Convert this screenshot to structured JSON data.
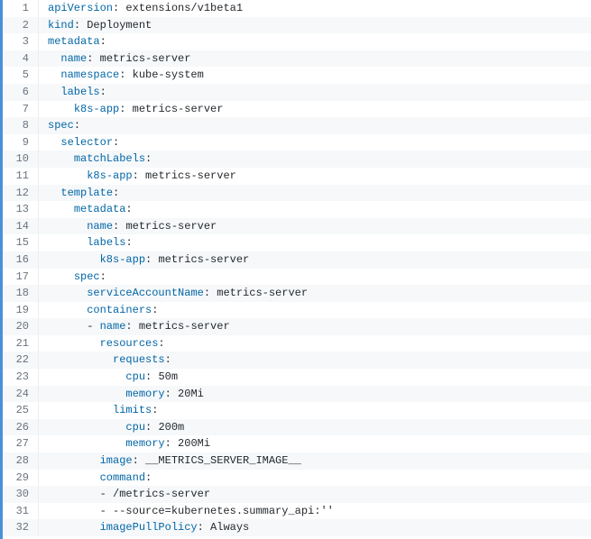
{
  "lines": [
    {
      "num": "1",
      "segments": [
        {
          "t": "apiVersion",
          "c": "k"
        },
        {
          "t": ": ",
          "c": "d"
        },
        {
          "t": "extensions/v1beta1",
          "c": "v"
        }
      ]
    },
    {
      "num": "2",
      "segments": [
        {
          "t": "kind",
          "c": "k"
        },
        {
          "t": ": ",
          "c": "d"
        },
        {
          "t": "Deployment",
          "c": "v"
        }
      ]
    },
    {
      "num": "3",
      "segments": [
        {
          "t": "metadata",
          "c": "k"
        },
        {
          "t": ":",
          "c": "d"
        }
      ]
    },
    {
      "num": "4",
      "segments": [
        {
          "t": "  ",
          "c": "d"
        },
        {
          "t": "name",
          "c": "k"
        },
        {
          "t": ": ",
          "c": "d"
        },
        {
          "t": "metrics-server",
          "c": "v"
        }
      ]
    },
    {
      "num": "5",
      "segments": [
        {
          "t": "  ",
          "c": "d"
        },
        {
          "t": "namespace",
          "c": "k"
        },
        {
          "t": ": ",
          "c": "d"
        },
        {
          "t": "kube-system",
          "c": "v"
        }
      ]
    },
    {
      "num": "6",
      "segments": [
        {
          "t": "  ",
          "c": "d"
        },
        {
          "t": "labels",
          "c": "k"
        },
        {
          "t": ":",
          "c": "d"
        }
      ]
    },
    {
      "num": "7",
      "segments": [
        {
          "t": "    ",
          "c": "d"
        },
        {
          "t": "k8s-app",
          "c": "k"
        },
        {
          "t": ": ",
          "c": "d"
        },
        {
          "t": "metrics-server",
          "c": "v"
        }
      ]
    },
    {
      "num": "8",
      "segments": [
        {
          "t": "spec",
          "c": "k"
        },
        {
          "t": ":",
          "c": "d"
        }
      ]
    },
    {
      "num": "9",
      "segments": [
        {
          "t": "  ",
          "c": "d"
        },
        {
          "t": "selector",
          "c": "k"
        },
        {
          "t": ":",
          "c": "d"
        }
      ]
    },
    {
      "num": "10",
      "segments": [
        {
          "t": "    ",
          "c": "d"
        },
        {
          "t": "matchLabels",
          "c": "k"
        },
        {
          "t": ":",
          "c": "d"
        }
      ]
    },
    {
      "num": "11",
      "segments": [
        {
          "t": "      ",
          "c": "d"
        },
        {
          "t": "k8s-app",
          "c": "k"
        },
        {
          "t": ": ",
          "c": "d"
        },
        {
          "t": "metrics-server",
          "c": "v"
        }
      ]
    },
    {
      "num": "12",
      "segments": [
        {
          "t": "  ",
          "c": "d"
        },
        {
          "t": "template",
          "c": "k"
        },
        {
          "t": ":",
          "c": "d"
        }
      ]
    },
    {
      "num": "13",
      "segments": [
        {
          "t": "    ",
          "c": "d"
        },
        {
          "t": "metadata",
          "c": "k"
        },
        {
          "t": ":",
          "c": "d"
        }
      ]
    },
    {
      "num": "14",
      "segments": [
        {
          "t": "      ",
          "c": "d"
        },
        {
          "t": "name",
          "c": "k"
        },
        {
          "t": ": ",
          "c": "d"
        },
        {
          "t": "metrics-server",
          "c": "v"
        }
      ]
    },
    {
      "num": "15",
      "segments": [
        {
          "t": "      ",
          "c": "d"
        },
        {
          "t": "labels",
          "c": "k"
        },
        {
          "t": ":",
          "c": "d"
        }
      ]
    },
    {
      "num": "16",
      "segments": [
        {
          "t": "        ",
          "c": "d"
        },
        {
          "t": "k8s-app",
          "c": "k"
        },
        {
          "t": ": ",
          "c": "d"
        },
        {
          "t": "metrics-server",
          "c": "v"
        }
      ]
    },
    {
      "num": "17",
      "segments": [
        {
          "t": "    ",
          "c": "d"
        },
        {
          "t": "spec",
          "c": "k"
        },
        {
          "t": ":",
          "c": "d"
        }
      ]
    },
    {
      "num": "18",
      "segments": [
        {
          "t": "      ",
          "c": "d"
        },
        {
          "t": "serviceAccountName",
          "c": "k"
        },
        {
          "t": ": ",
          "c": "d"
        },
        {
          "t": "metrics-server",
          "c": "v"
        }
      ]
    },
    {
      "num": "19",
      "segments": [
        {
          "t": "      ",
          "c": "d"
        },
        {
          "t": "containers",
          "c": "k"
        },
        {
          "t": ":",
          "c": "d"
        }
      ]
    },
    {
      "num": "20",
      "segments": [
        {
          "t": "      - ",
          "c": "d"
        },
        {
          "t": "name",
          "c": "k"
        },
        {
          "t": ": ",
          "c": "d"
        },
        {
          "t": "metrics-server",
          "c": "v"
        }
      ]
    },
    {
      "num": "21",
      "segments": [
        {
          "t": "        ",
          "c": "d"
        },
        {
          "t": "resources",
          "c": "k"
        },
        {
          "t": ":",
          "c": "d"
        }
      ]
    },
    {
      "num": "22",
      "segments": [
        {
          "t": "          ",
          "c": "d"
        },
        {
          "t": "requests",
          "c": "k"
        },
        {
          "t": ":",
          "c": "d"
        }
      ]
    },
    {
      "num": "23",
      "segments": [
        {
          "t": "            ",
          "c": "d"
        },
        {
          "t": "cpu",
          "c": "k"
        },
        {
          "t": ": ",
          "c": "d"
        },
        {
          "t": "50m",
          "c": "v"
        }
      ]
    },
    {
      "num": "24",
      "segments": [
        {
          "t": "            ",
          "c": "d"
        },
        {
          "t": "memory",
          "c": "k"
        },
        {
          "t": ": ",
          "c": "d"
        },
        {
          "t": "20Mi",
          "c": "v"
        }
      ]
    },
    {
      "num": "25",
      "segments": [
        {
          "t": "          ",
          "c": "d"
        },
        {
          "t": "limits",
          "c": "k"
        },
        {
          "t": ":",
          "c": "d"
        }
      ]
    },
    {
      "num": "26",
      "segments": [
        {
          "t": "            ",
          "c": "d"
        },
        {
          "t": "cpu",
          "c": "k"
        },
        {
          "t": ": ",
          "c": "d"
        },
        {
          "t": "200m",
          "c": "v"
        }
      ]
    },
    {
      "num": "27",
      "segments": [
        {
          "t": "            ",
          "c": "d"
        },
        {
          "t": "memory",
          "c": "k"
        },
        {
          "t": ": ",
          "c": "d"
        },
        {
          "t": "200Mi",
          "c": "v"
        }
      ]
    },
    {
      "num": "28",
      "segments": [
        {
          "t": "        ",
          "c": "d"
        },
        {
          "t": "image",
          "c": "k"
        },
        {
          "t": ": ",
          "c": "d"
        },
        {
          "t": "__METRICS_SERVER_IMAGE__",
          "c": "v"
        }
      ]
    },
    {
      "num": "29",
      "segments": [
        {
          "t": "        ",
          "c": "d"
        },
        {
          "t": "command",
          "c": "k"
        },
        {
          "t": ":",
          "c": "d"
        }
      ]
    },
    {
      "num": "30",
      "segments": [
        {
          "t": "        - ",
          "c": "d"
        },
        {
          "t": "/metrics-server",
          "c": "v"
        }
      ]
    },
    {
      "num": "31",
      "segments": [
        {
          "t": "        - ",
          "c": "d"
        },
        {
          "t": "--source=kubernetes.summary_api:''",
          "c": "v"
        }
      ]
    },
    {
      "num": "32",
      "segments": [
        {
          "t": "        ",
          "c": "d"
        },
        {
          "t": "imagePullPolicy",
          "c": "k"
        },
        {
          "t": ": ",
          "c": "d"
        },
        {
          "t": "Always",
          "c": "v"
        }
      ]
    }
  ]
}
